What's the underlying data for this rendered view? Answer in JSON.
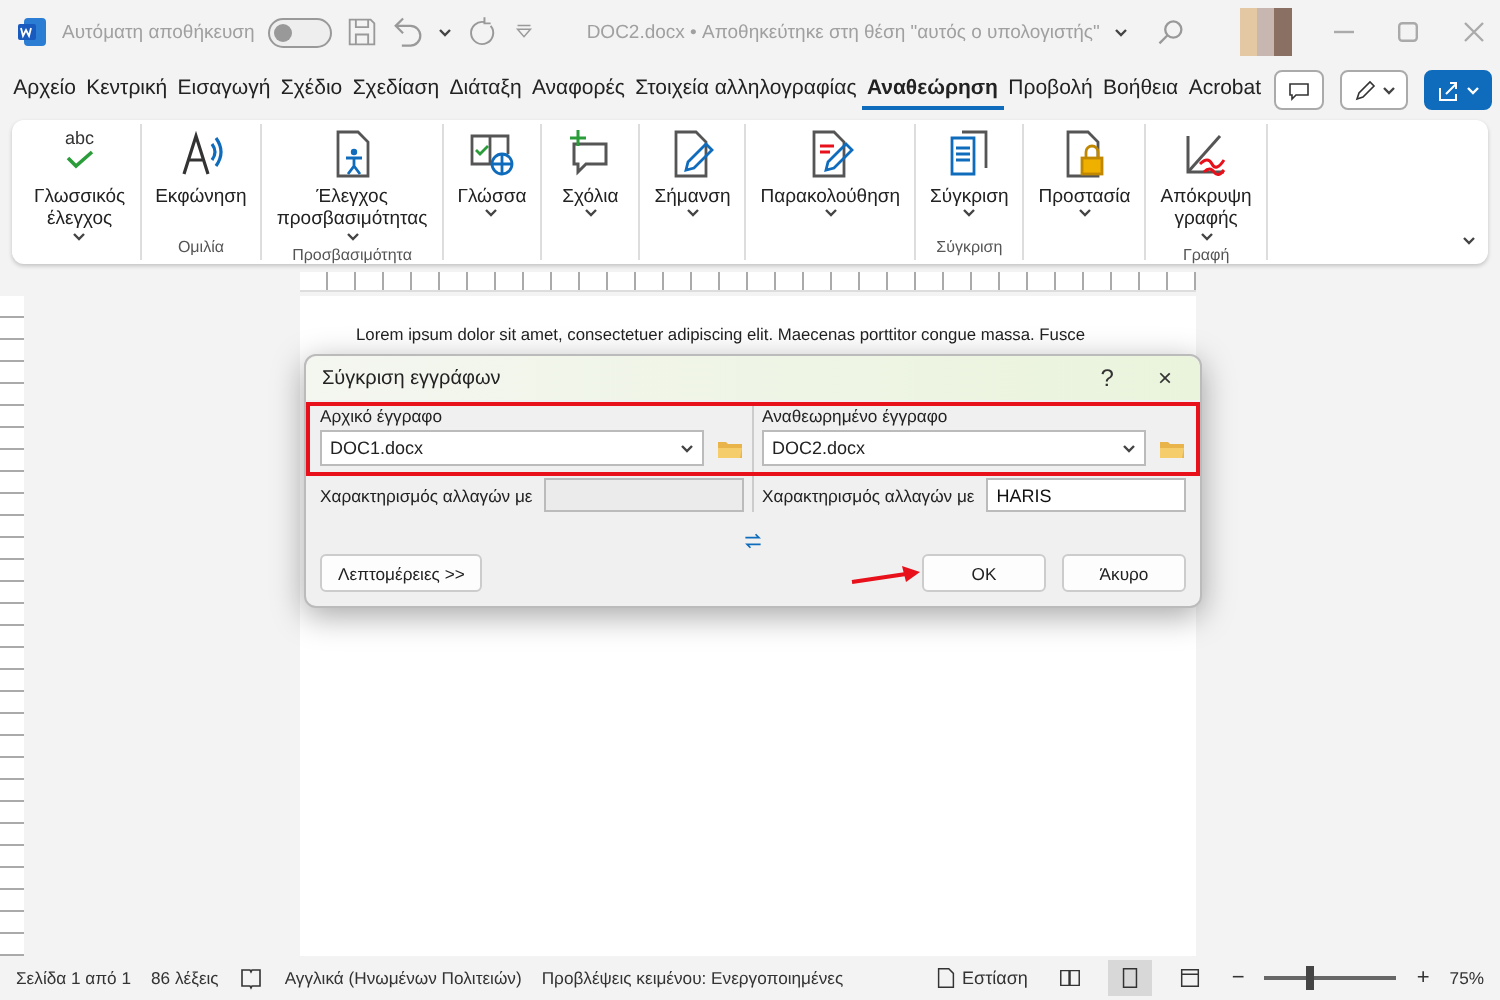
{
  "title_bar": {
    "autosave_label": "Αυτόματη αποθήκευση",
    "autosave_on": false,
    "document_title": "DOC2.docx • Αποθηκεύτηκε στη θέση \"αυτός ο υπολογιστής\""
  },
  "tabs": [
    {
      "label": "Αρχείο",
      "selected": false
    },
    {
      "label": "Κεντρική",
      "selected": false
    },
    {
      "label": "Εισαγωγή",
      "selected": false
    },
    {
      "label": "Σχέδιο",
      "selected": false
    },
    {
      "label": "Σχεδίαση",
      "selected": false
    },
    {
      "label": "Διάταξη",
      "selected": false
    },
    {
      "label": "Αναφορές",
      "selected": false
    },
    {
      "label": "Στοιχεία αλληλογραφίας",
      "selected": false
    },
    {
      "label": "Αναθεώρηση",
      "selected": true
    },
    {
      "label": "Προβολή",
      "selected": false
    },
    {
      "label": "Βοήθεια",
      "selected": false
    },
    {
      "label": "Acrobat",
      "selected": false
    }
  ],
  "ribbon": {
    "groups": [
      {
        "items": [
          {
            "icon_text": "abc",
            "label": "Γλωσσικός\nέλεγχος",
            "dropdown": true
          }
        ]
      },
      {
        "label": "Ομιλία",
        "items": [
          {
            "label": "Εκφώνηση",
            "dropdown": false
          }
        ]
      },
      {
        "label": "Προσβασιμότητα",
        "items": [
          {
            "label": "Έλεγχος\nπροσβασιμότητας",
            "dropdown": true
          }
        ]
      },
      {
        "items": [
          {
            "label": "Γλώσσα",
            "dropdown": true
          }
        ]
      },
      {
        "items": [
          {
            "label": "Σχόλια",
            "dropdown": true
          }
        ]
      },
      {
        "items": [
          {
            "label": "Σήμανση",
            "dropdown": true
          }
        ]
      },
      {
        "items": [
          {
            "label": "Παρακολούθηση",
            "dropdown": true
          }
        ]
      },
      {
        "label": "Σύγκριση",
        "items": [
          {
            "label": "Σύγκριση",
            "dropdown": true
          }
        ]
      },
      {
        "items": [
          {
            "label": "Προστασία",
            "dropdown": true
          }
        ]
      },
      {
        "label": "Γραφή",
        "items": [
          {
            "label": "Απόκρυψη\nγραφής",
            "dropdown": true
          }
        ]
      }
    ]
  },
  "document": {
    "text": "Lorem ipsum dolor sit amet, consectetuer adipiscing elit. Maecenas porttitor congue massa. Fusce"
  },
  "dialog": {
    "title": "Σύγκριση εγγράφων",
    "help": "?",
    "close": "×",
    "columns": [
      {
        "label": "Αρχικό έγγραφο",
        "file": "DOC1.docx",
        "mark_label": "Χαρακτηρισμός αλλαγών με",
        "disabled": true
      },
      {
        "label": "Αναθεωρημένο έγγραφο",
        "file": "DOC2.docx",
        "mark_label": "Χαρακτηρισμός αλλαγών με",
        "mark_value": "HARIS",
        "disabled": false
      }
    ],
    "more_button": "Λεπτομέρειες >>",
    "ok_button": "OK",
    "cancel_button": "Άκυρο"
  },
  "status_bar": {
    "page": "Σελίδα 1 από 1",
    "words": "86 λέξεις",
    "language": "Αγγλικά (Ηνωμένων Πολιτειών)",
    "predictions": "Προβλέψεις κειμένου: Ενεργοποιημένες",
    "focus": "Εστίαση",
    "views": [
      {
        "selected": false
      },
      {
        "selected": true
      },
      {
        "selected": false
      }
    ],
    "zoom": {
      "minus": "−",
      "level": 0.35,
      "plus": "+",
      "reading": "75%"
    }
  }
}
